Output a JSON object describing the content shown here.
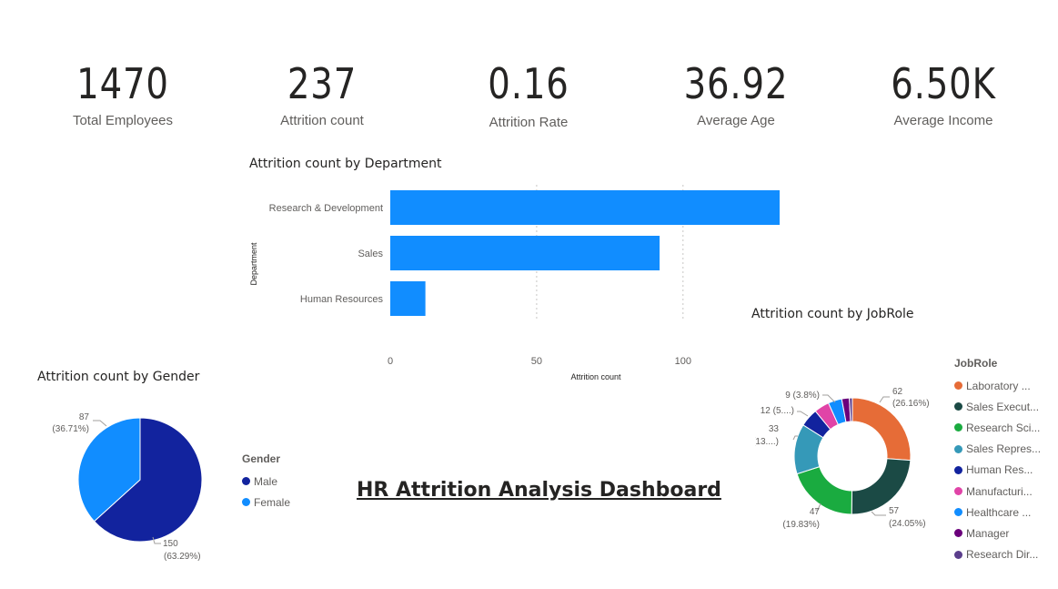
{
  "kpis": [
    {
      "value": "1470",
      "label": "Total Employees"
    },
    {
      "value": "237",
      "label": "Attrition count"
    },
    {
      "value": "0.16",
      "label": "Attrition Rate"
    },
    {
      "value": "36.92",
      "label": "Average Age"
    },
    {
      "value": "6.50K",
      "label": "Average Income"
    }
  ],
  "dashboard_title": "HR Attrition Analysis Dashboard",
  "chart_data": [
    {
      "type": "bar",
      "orientation": "horizontal",
      "title": "Attrition count by Department",
      "xlabel": "Attrition count",
      "ylabel": "Department",
      "categories": [
        "Research & Development",
        "Sales",
        "Human Resources"
      ],
      "values": [
        133,
        92,
        12
      ],
      "xlim": [
        0,
        133
      ],
      "xticks": [
        "0",
        "50",
        "100"
      ],
      "grid": true,
      "color": "#118DFF"
    },
    {
      "type": "pie",
      "title": "Attrition count by Gender",
      "legend_title": "Gender",
      "legend_position": "right",
      "slices": [
        {
          "label": "Male",
          "value": 150,
          "text": "150",
          "pct": "(63.29%)",
          "color": "#12239E"
        },
        {
          "label": "Female",
          "value": 87,
          "text": "87",
          "pct": "(36.71%)",
          "color": "#118DFF"
        }
      ]
    },
    {
      "type": "pie",
      "donut": true,
      "title": "Attrition count by JobRole",
      "legend_title": "JobRole",
      "legend_position": "right",
      "slices": [
        {
          "label": "Laboratory ...",
          "value": 62,
          "text": "62",
          "pct": "(26.16%)",
          "color": "#E66C37"
        },
        {
          "label": "Sales Execut...",
          "value": 57,
          "text": "57",
          "pct": "(24.05%)",
          "color": "#1B4A45"
        },
        {
          "label": "Research Sci...",
          "value": 47,
          "text": "47",
          "pct": "(19.83%)",
          "color": "#1AAB40"
        },
        {
          "label": "Sales Repres...",
          "value": 33,
          "text": "33",
          "pct": "(13....)",
          "color": "#3599B8"
        },
        {
          "label": "Human Res...",
          "value": 12,
          "text": "12 (5....)",
          "pct": "",
          "color": "#12239E"
        },
        {
          "label": "Manufacturi...",
          "value": 10,
          "text": "",
          "pct": "",
          "color": "#E044A7"
        },
        {
          "label": "Healthcare ...",
          "value": 9,
          "text": "9 (3.8%)",
          "pct": "",
          "color": "#118DFF"
        },
        {
          "label": "Manager",
          "value": 5,
          "text": "",
          "pct": "",
          "color": "#6B007B"
        },
        {
          "label": "Research Dir...",
          "value": 2,
          "text": "",
          "pct": "",
          "color": "#5B3E8C"
        }
      ]
    }
  ]
}
